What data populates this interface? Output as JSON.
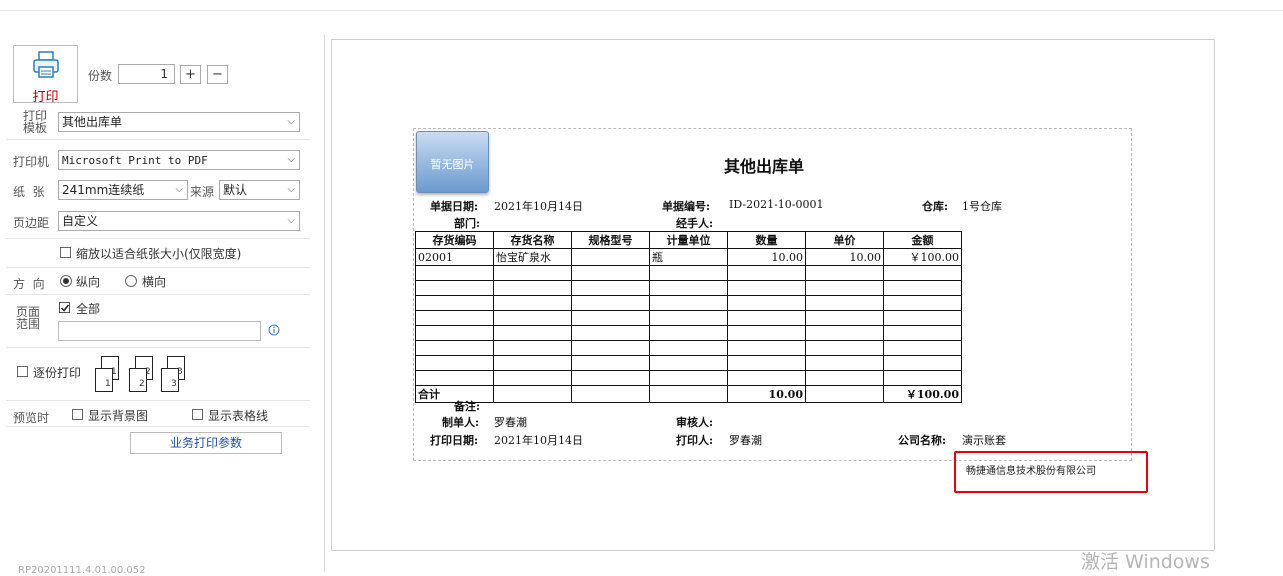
{
  "window": {
    "title_fragment": ""
  },
  "print_button": {
    "label": "打印",
    "icon": "printer-icon"
  },
  "copies": {
    "label": "份数",
    "value": "1",
    "plus": "+",
    "minus": "−"
  },
  "template": {
    "label_line1": "打印",
    "label_line2": "模板",
    "value": "其他出库单"
  },
  "printer": {
    "label": "打印机",
    "value": "Microsoft Print to PDF"
  },
  "paper": {
    "label": "纸  张",
    "value": "241mm连续纸",
    "source_label": "来源",
    "source_value": "默认"
  },
  "margin": {
    "label": "页边距",
    "value": "自定义"
  },
  "fit_paper": {
    "label": "缩放以适合纸张大小(仅限宽度)",
    "checked": false
  },
  "orientation": {
    "label": "方  向",
    "portrait": "纵向",
    "landscape": "横向",
    "selected": "portrait"
  },
  "page_range": {
    "label_line1": "页面",
    "label_line2": "范围",
    "all_label": "全部",
    "all_checked": true,
    "input_value": ""
  },
  "collate": {
    "label": "逐份打印",
    "checked": false,
    "pages": [
      "1",
      "1",
      "2",
      "2",
      "3",
      "3"
    ]
  },
  "preview_options": {
    "label": "预览时",
    "show_bg": "显示背景图",
    "show_grid": "显示表格线"
  },
  "business_params_button": "业务打印参数",
  "document": {
    "image_placeholder": "暂无图片",
    "title": "其他出库单",
    "doc_date_label": "单据日期:",
    "doc_date": "2021年10月14日",
    "doc_no_label": "单据编号:",
    "doc_no": "ID-2021-10-0001",
    "warehouse_label": "仓库:",
    "warehouse": "1号仓库",
    "dept_label": "部门:",
    "handler_label": "经手人:",
    "columns": [
      "存货编码",
      "存货名称",
      "规格型号",
      "计量单位",
      "数量",
      "单价",
      "金额"
    ],
    "rows": [
      [
        "02001",
        "怡宝矿泉水",
        "",
        "瓶",
        "10.00",
        "10.00",
        "￥100.00"
      ]
    ],
    "total_label": "合计",
    "total_qty": "10.00",
    "total_amount": "￥100.00",
    "remark_label": "备注:",
    "maker_label": "制单人:",
    "maker": "罗春潮",
    "reviewer_label": "审核人:",
    "print_date_label": "打印日期:",
    "print_date": "2021年10月14日",
    "printer_person_label": "打印人:",
    "printer_person": "罗春潮",
    "company_label": "公司名称:",
    "company": "演示账套",
    "footer_company": "畅捷通信息技术股份有限公司"
  },
  "watermark": "激活 Windows",
  "version": "RP20201111.4.01.00.052",
  "colors": {
    "accent_red": "#e60012",
    "print_label_red": "#c00000",
    "link_blue": "#1f4fa8"
  }
}
